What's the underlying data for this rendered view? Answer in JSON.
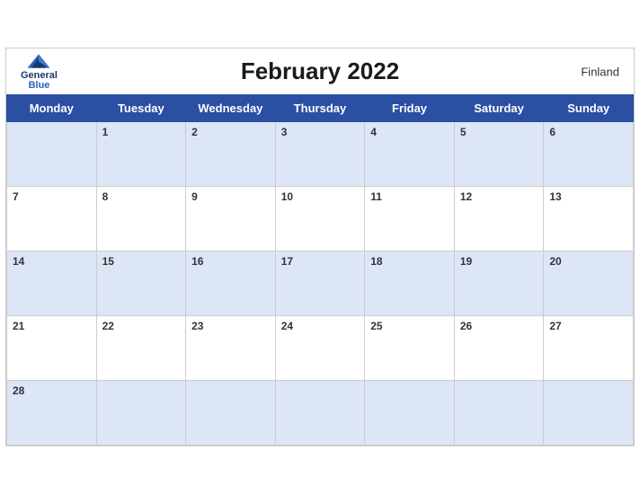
{
  "header": {
    "title": "February 2022",
    "country": "Finland",
    "logo": {
      "line1": "General",
      "line2": "Blue"
    }
  },
  "weekdays": [
    "Monday",
    "Tuesday",
    "Wednesday",
    "Thursday",
    "Friday",
    "Saturday",
    "Sunday"
  ],
  "weeks": [
    [
      "",
      "1",
      "2",
      "3",
      "4",
      "5",
      "6"
    ],
    [
      "7",
      "8",
      "9",
      "10",
      "11",
      "12",
      "13"
    ],
    [
      "14",
      "15",
      "16",
      "17",
      "18",
      "19",
      "20"
    ],
    [
      "21",
      "22",
      "23",
      "24",
      "25",
      "26",
      "27"
    ],
    [
      "28",
      "",
      "",
      "",
      "",
      "",
      ""
    ]
  ]
}
